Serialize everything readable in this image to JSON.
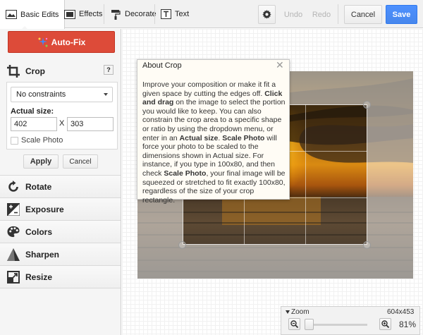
{
  "toolbar": {
    "tabs": [
      {
        "label": "Basic Edits",
        "icon": "photo-icon"
      },
      {
        "label": "Effects",
        "icon": "film-icon"
      },
      {
        "label": "Decorate",
        "icon": "paint-roller-icon"
      },
      {
        "label": "Text",
        "icon": "text-icon"
      }
    ],
    "undo_label": "Undo",
    "redo_label": "Redo",
    "cancel_label": "Cancel",
    "save_label": "Save"
  },
  "sidebar": {
    "autofix_label": "Auto-Fix",
    "crop": {
      "title": "Crop",
      "help": "?",
      "constraint_selected": "No constraints",
      "actual_size_label": "Actual size:",
      "width": "402",
      "by": "X",
      "height": "303",
      "scale_photo_label": "Scale Photo",
      "scale_photo_checked": false,
      "apply_label": "Apply",
      "cancel_label": "Cancel"
    },
    "tools": [
      {
        "label": "Rotate",
        "icon": "rotate-icon"
      },
      {
        "label": "Exposure",
        "icon": "exposure-icon"
      },
      {
        "label": "Colors",
        "icon": "palette-icon"
      },
      {
        "label": "Sharpen",
        "icon": "sharpen-icon"
      },
      {
        "label": "Resize",
        "icon": "resize-icon"
      }
    ]
  },
  "about_crop": {
    "title": "About Crop",
    "close": "✕",
    "paragraph": [
      {
        "t": "Improve your composition or make it fit a given space by cutting the edges off. "
      },
      {
        "t": "Click and drag",
        "b": true
      },
      {
        "t": " on the image to select the portion you would like to keep. You can also constrain the crop area to a specific shape or ratio by using the dropdown menu, or enter in an "
      },
      {
        "t": "Actual size",
        "b": true
      },
      {
        "t": ". "
      },
      {
        "t": "Scale Photo",
        "b": true
      },
      {
        "t": " will force your photo to be scaled to the dimensions shown in Actual size. For instance, if you type in 100x80, and then check "
      },
      {
        "t": "Scale Photo",
        "b": true
      },
      {
        "t": ", your final image will be squeezed or stretched to fit exactly 100x80, regardless of the size of your crop rectangle."
      }
    ]
  },
  "zoom": {
    "title": "Zoom",
    "dimensions": "604x453",
    "percent": "81%",
    "level": 0.0
  },
  "colors": {
    "save": "#4d90fe",
    "autofix": "#dd4b39"
  }
}
